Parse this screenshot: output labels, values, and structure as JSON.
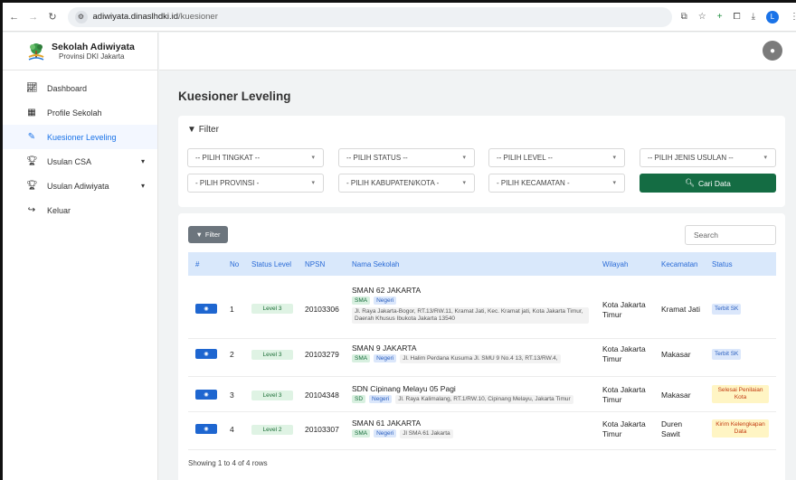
{
  "browser": {
    "url_host": "adiwiyata.dinaslhdki.id",
    "url_path": "/kuesioner",
    "profile_initial": "L"
  },
  "sidebar": {
    "brand_title": "Sekolah Adiwiyata",
    "brand_subtitle": "Provinsi DKI Jakarta",
    "items": [
      {
        "label": "Dashboard",
        "icon": "chart-line-icon"
      },
      {
        "label": "Profile Sekolah",
        "icon": "building-icon"
      },
      {
        "label": "Kuesioner Leveling",
        "icon": "edit-icon",
        "active": true
      },
      {
        "label": "Usulan CSA",
        "icon": "trophy-icon",
        "has_submenu": true
      },
      {
        "label": "Usulan Adiwiyata",
        "icon": "trophy-icon",
        "has_submenu": true
      },
      {
        "label": "Keluar",
        "icon": "logout-icon"
      }
    ]
  },
  "page": {
    "title": "Kuesioner Leveling"
  },
  "filter": {
    "heading": "Filter",
    "selects": {
      "tingkat": "-- PILIH TINGKAT --",
      "status": "-- PILIH STATUS --",
      "level": "-- PILIH LEVEL --",
      "jenis": "-- PILIH JENIS USULAN --",
      "provinsi": "- PILIH PROVINSI -",
      "kabupaten": "- PILIH KABUPATEN/KOTA -",
      "kecamatan": "- PILIH KECAMATAN -"
    },
    "search_button": "Cari Data"
  },
  "table": {
    "filter_button": "Filter",
    "search_placeholder": "Search",
    "headers": [
      "#",
      "No",
      "Status Level",
      "NPSN",
      "Nama Sekolah",
      "Wilayah",
      "Kecamatan",
      "Status"
    ],
    "rows": [
      {
        "no": "1",
        "level": "Level 3",
        "npsn": "20103306",
        "nama": "SMAN 62 JAKARTA",
        "jenjang": "SMA",
        "tipe": "Negeri",
        "alamat": "Jl. Raya Jakarta-Bogor, RT.13/RW.11, Kramat Jati, Kec. Kramat jati, Kota Jakarta Timur, Daerah Khusus Ibukota Jakarta 13540",
        "wilayah": "Kota Jakarta Timur",
        "kecamatan": "Kramat Jati",
        "status": "Terbit SK"
      },
      {
        "no": "2",
        "level": "Level 3",
        "npsn": "20103279",
        "nama": "SMAN 9 JAKARTA",
        "jenjang": "SMA",
        "tipe": "Negeri",
        "alamat": "Jl. Halim Perdana Kusuma Jl. SMU 9 No.4 13, RT.13/RW.4,",
        "wilayah": "Kota Jakarta Timur",
        "kecamatan": "Makasar",
        "status": "Terbit SK"
      },
      {
        "no": "3",
        "level": "Level 3",
        "npsn": "20104348",
        "nama": "SDN Cipinang Melayu 05 Pagi",
        "jenjang": "SD",
        "tipe": "Negeri",
        "alamat": "Jl. Raya Kalimalang, RT.1/RW.10, Cipinang Melayu, Jakarta Timur",
        "wilayah": "Kota Jakarta Timur",
        "kecamatan": "Makasar",
        "status": "Selesai Penilaian Kota"
      },
      {
        "no": "4",
        "level": "Level 2",
        "npsn": "20103307",
        "nama": "SMAN 61 JAKARTA",
        "jenjang": "SMA",
        "tipe": "Negeri",
        "alamat": "Jl SMA 61 Jakarta",
        "wilayah": "Kota Jakarta Timur",
        "kecamatan": "Duren Sawit",
        "status": "Kirim Kelengkapan Data"
      }
    ],
    "footer": "Showing 1 to 4 of 4 rows"
  },
  "colors": {
    "primary": "#1a73e8",
    "header_bg": "#d9e8fb",
    "search_btn": "#146c43",
    "level_badge": "#dff3e4",
    "status_yellow": "#fff5c4"
  }
}
